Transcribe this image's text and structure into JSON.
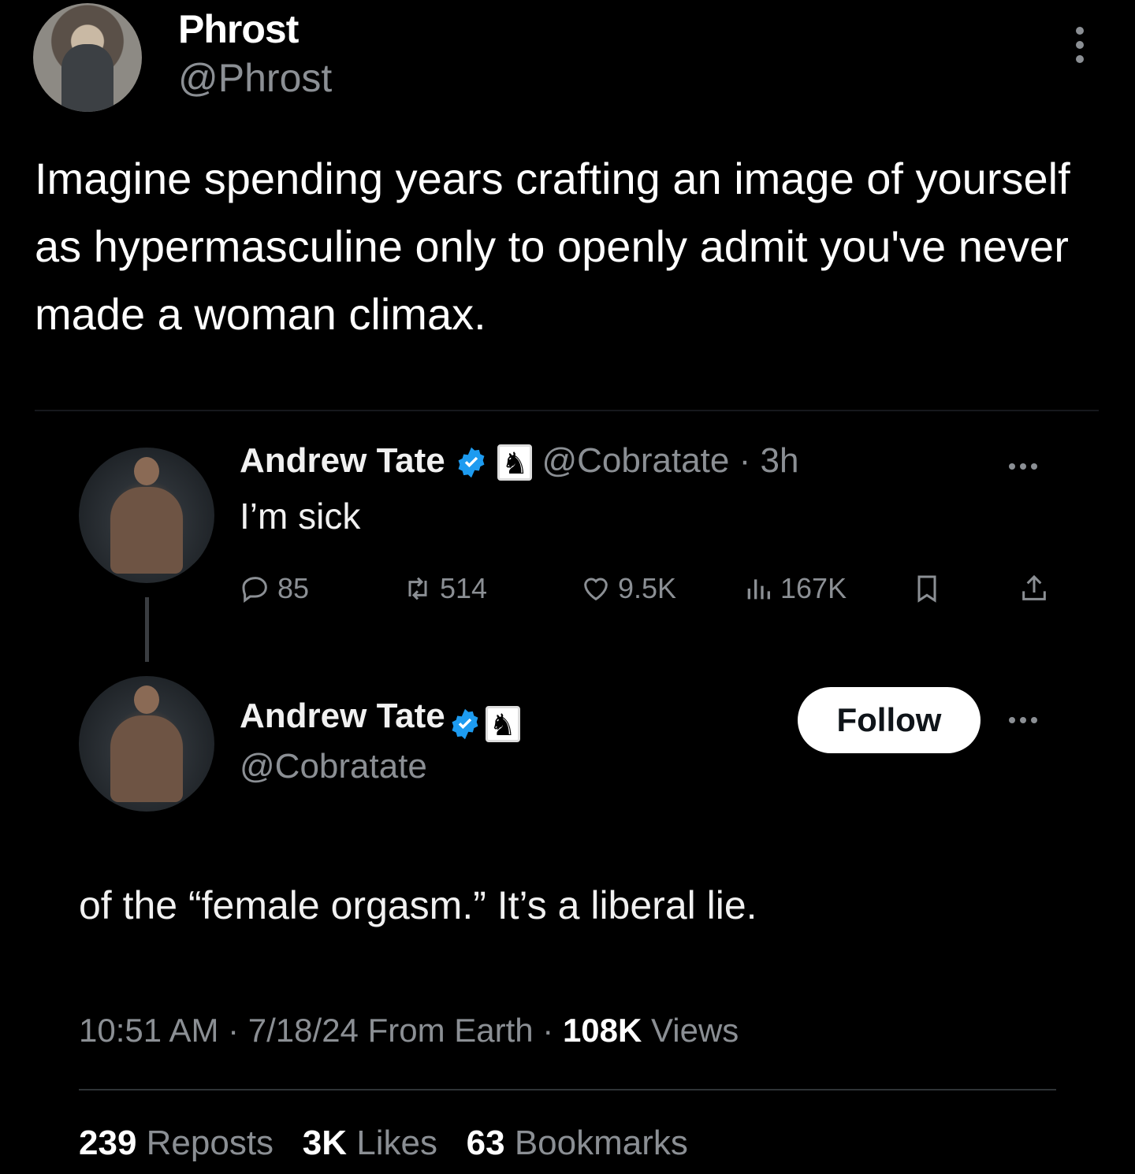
{
  "post": {
    "author_name": "Phrost",
    "author_handle": "@Phrost",
    "text": "Imagine spending years crafting an image of yourself as hypermasculine only to openly admit you've never made a woman climax."
  },
  "quoted": {
    "first_tweet": {
      "name": "Andrew Tate",
      "handle_time": "@Cobratate · 3h",
      "text": "I’m sick",
      "stats": {
        "replies": "85",
        "reposts": "514",
        "likes": "9.5K",
        "views": "167K"
      }
    },
    "second_tweet": {
      "name": "Andrew Tate",
      "handle": "@Cobratate",
      "follow_label": "Follow",
      "text": "of the “female orgasm.” It’s a liberal lie.",
      "meta_time": "10:51 AM · 7/18/24 From Earth · ",
      "meta_views_count": "108K",
      "meta_views_label": " Views",
      "reposts_count": "239",
      "reposts_label": " Reposts",
      "likes_count": "3K",
      "likes_label": " Likes",
      "bookmarks_count": "63",
      "bookmarks_label": " Bookmarks"
    }
  },
  "colors": {
    "background": "#000000",
    "secondary_text": "#8b8f94",
    "verified_blue": "#1d9bf0"
  },
  "icons": [
    "kebab-menu-icon",
    "verified-badge-icon",
    "chess-knight-icon",
    "reply-icon",
    "repost-icon",
    "like-icon",
    "views-icon",
    "bookmark-icon",
    "share-icon",
    "more-horizontal-icon"
  ]
}
